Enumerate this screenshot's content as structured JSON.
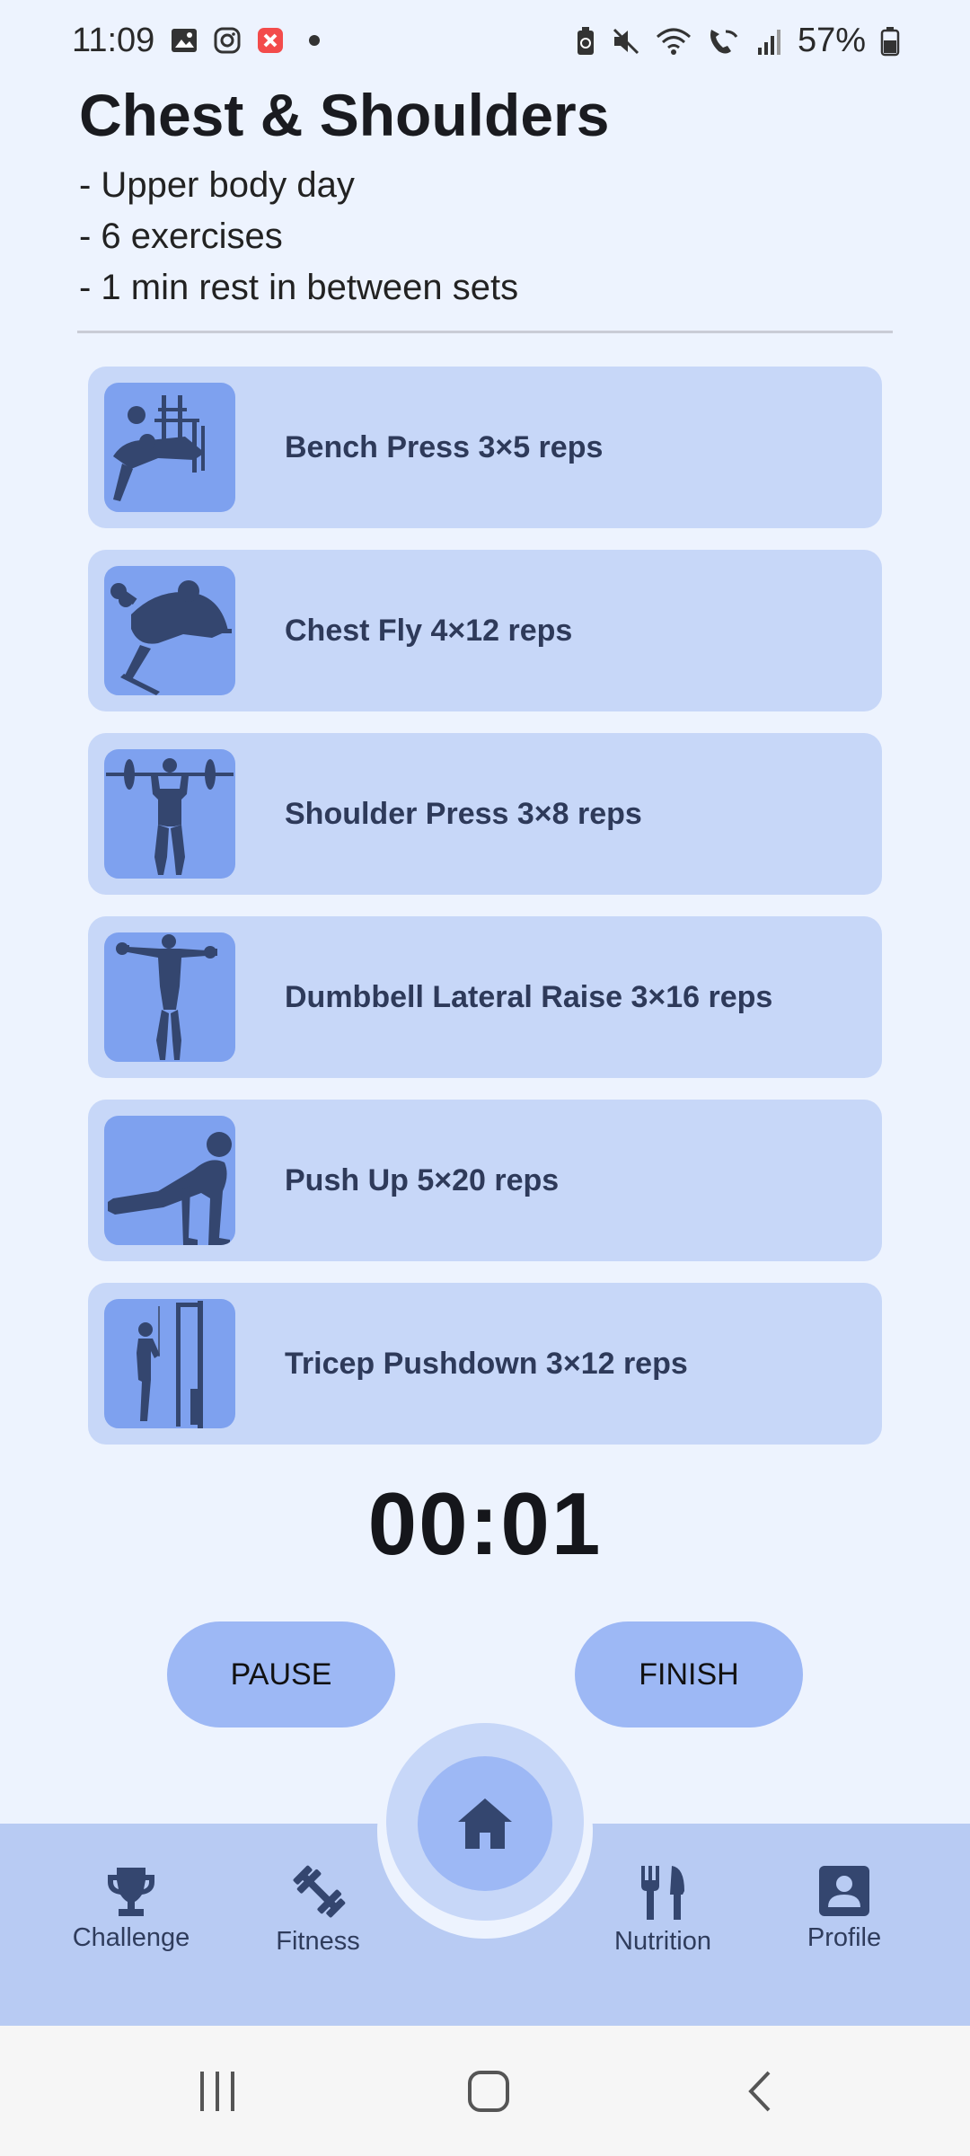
{
  "status_bar": {
    "time": "11:09",
    "battery": "57%",
    "left_icons": [
      "gallery-icon",
      "instagram-icon",
      "notification-app-icon",
      "dot-icon"
    ],
    "right_icons": [
      "battery-saver-icon",
      "mute-icon",
      "wifi-icon",
      "wifi-calling-icon",
      "signal-icon",
      "battery-icon"
    ]
  },
  "workout": {
    "title": "Chest & Shoulders",
    "details": [
      "- Upper body day",
      "- 6 exercises",
      "- 1 min rest in between sets"
    ]
  },
  "exercises": [
    {
      "label": "Bench Press 3×5 reps",
      "icon": "bench-press-icon"
    },
    {
      "label": "Chest Fly 4×12 reps",
      "icon": "chest-fly-icon"
    },
    {
      "label": "Shoulder Press 3×8 reps",
      "icon": "shoulder-press-icon"
    },
    {
      "label": "Dumbbell Lateral Raise 3×16 reps",
      "icon": "lateral-raise-icon"
    },
    {
      "label": "Push Up 5×20 reps",
      "icon": "push-up-icon"
    },
    {
      "label": "Tricep Pushdown 3×12 reps",
      "icon": "tricep-pushdown-icon"
    }
  ],
  "timer": "00:01",
  "buttons": {
    "pause": "PAUSE",
    "finish": "FINISH"
  },
  "bottom_nav": {
    "items": [
      {
        "label": "Challenge",
        "icon": "trophy-icon"
      },
      {
        "label": "Fitness",
        "icon": "dumbbell-icon"
      },
      {
        "label": "Nutrition",
        "icon": "fork-knife-icon"
      },
      {
        "label": "Profile",
        "icon": "profile-icon"
      }
    ],
    "center_icon": "home-icon"
  },
  "colors": {
    "background": "#edf3fe",
    "card": "#c7d7f8",
    "thumb": "#7ea1ef",
    "button": "#9db8f5",
    "nav": "#b8cbf3"
  }
}
